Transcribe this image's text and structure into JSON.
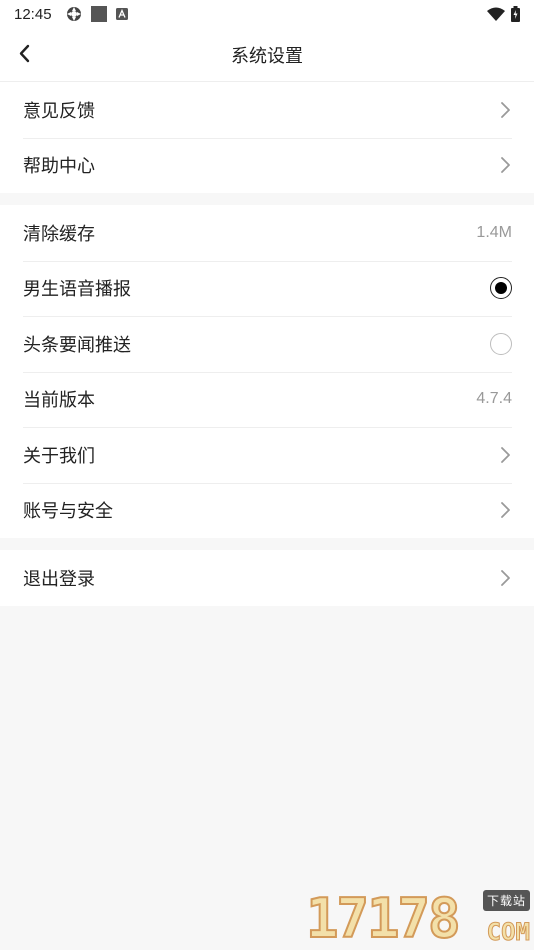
{
  "status_bar": {
    "time": "12:45"
  },
  "header": {
    "title": "系统设置"
  },
  "groups": [
    {
      "items": [
        {
          "label": "意见反馈",
          "type": "arrow"
        },
        {
          "label": "帮助中心",
          "type": "arrow"
        }
      ]
    },
    {
      "items": [
        {
          "label": "清除缓存",
          "type": "value",
          "value": "1.4M"
        },
        {
          "label": "男生语音播报",
          "type": "radio",
          "checked": true
        },
        {
          "label": "头条要闻推送",
          "type": "radio",
          "checked": false
        },
        {
          "label": "当前版本",
          "type": "value",
          "value": "4.7.4"
        },
        {
          "label": "关于我们",
          "type": "arrow"
        },
        {
          "label": "账号与安全",
          "type": "arrow"
        }
      ]
    },
    {
      "items": [
        {
          "label": "退出登录",
          "type": "arrow"
        }
      ]
    }
  ],
  "watermark": {
    "number": "17178",
    "badge": "下载站",
    "domain": "COM"
  },
  "icons": [
    "back-arrow-icon",
    "chevron-right-icon",
    "wifi-icon",
    "battery-icon"
  ]
}
